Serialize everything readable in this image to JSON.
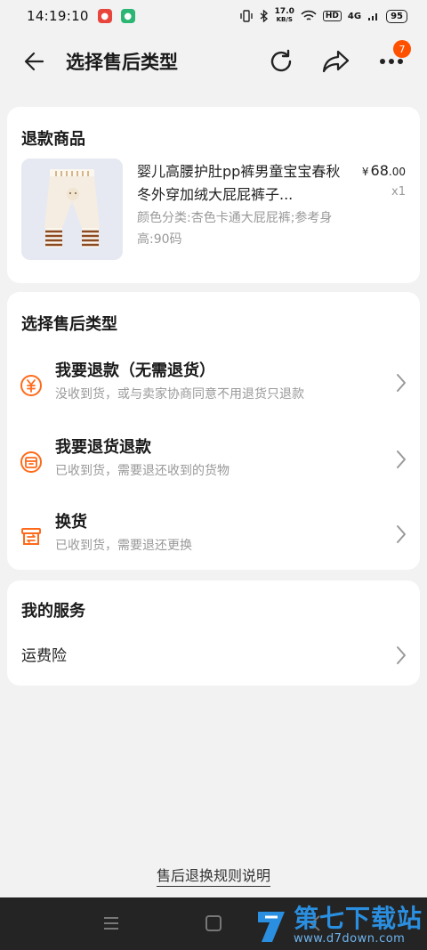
{
  "status_bar": {
    "time": "14:19:10",
    "speed_value": "17.0",
    "speed_unit": "KB/S",
    "hd": "HD",
    "network": "4G",
    "battery": "95"
  },
  "nav": {
    "title": "选择售后类型",
    "menu_badge": "7"
  },
  "refund_product": {
    "section_title": "退款商品",
    "name": "婴儿高腰护肚pp裤男童宝宝春秋冬外穿加绒大屁屁裤子...",
    "spec": "颜色分类:杏色卡通大屁屁裤;参考身高:90码",
    "price_symbol": "¥",
    "price_integer": "68",
    "price_decimal": ".00",
    "quantity": "x1"
  },
  "aftersale_types": {
    "section_title": "选择售后类型",
    "options": [
      {
        "title": "我要退款（无需退货）",
        "desc": "没收到货，或与卖家协商同意不用退货只退款",
        "icon": "refund-yen-icon"
      },
      {
        "title": "我要退货退款",
        "desc": "已收到货，需要退还收到的货物",
        "icon": "return-box-icon"
      },
      {
        "title": "换货",
        "desc": "已收到货，需要退还更换",
        "icon": "exchange-box-icon"
      }
    ]
  },
  "services": {
    "section_title": "我的服务",
    "items": [
      {
        "label": "运费险"
      }
    ]
  },
  "footer": {
    "rules_link": "售后退换规则说明"
  },
  "watermark": {
    "name": "第七下载站",
    "url": "www.d7down.com"
  },
  "colors": {
    "accent": "#ff5000",
    "icon_orange": "#ff6a1a",
    "background": "#f2f2f2"
  }
}
